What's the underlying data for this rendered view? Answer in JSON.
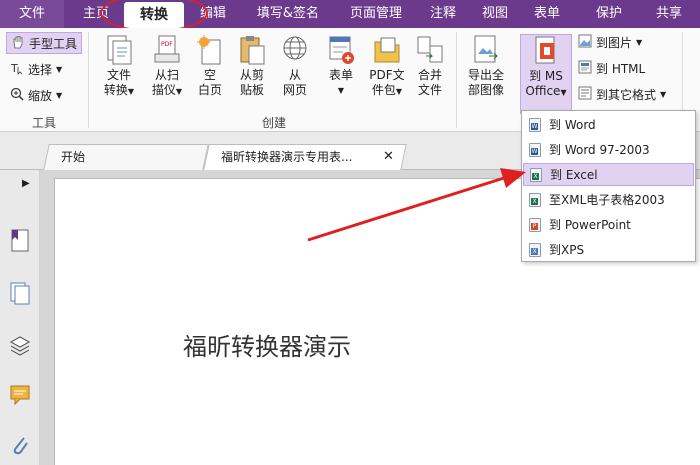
{
  "menu_tabs": {
    "file": "文件",
    "home": "主页",
    "convert": "转换",
    "edit": "编辑",
    "fill_sign": "填写&签名",
    "page_manage": "页面管理",
    "annotate": "注释",
    "view": "视图",
    "form": "表单",
    "protect": "保护",
    "share": "共享"
  },
  "tools_group": {
    "hand_tool": "手型工具",
    "select": "选择",
    "zoom": "缩放",
    "label": "工具"
  },
  "create_group": {
    "label": "创建",
    "file_convert": [
      "文件",
      "转换"
    ],
    "from_scanner": [
      "从扫",
      "描仪"
    ],
    "blank_page": [
      "空",
      "白页"
    ],
    "from_clipboard": [
      "从剪",
      "贴板"
    ],
    "from_web": [
      "从",
      "网页"
    ],
    "form": [
      "表单",
      ""
    ],
    "pdf_package": [
      "PDF文",
      "件包"
    ],
    "merge_files": [
      "合并",
      "文件"
    ]
  },
  "export_group": {
    "export_all_images": [
      "导出全",
      "部图像"
    ],
    "to_ms_office": [
      "到 MS",
      "Office"
    ],
    "to_image": "到图片",
    "to_html": "到 HTML",
    "to_other": "到其它格式"
  },
  "doc_tabs": {
    "start": "开始",
    "current": "福昕转换器演示专用表..."
  },
  "page_text": "福昕转换器演示",
  "dropdown_items": [
    {
      "label": "到 Word",
      "type": "word"
    },
    {
      "label": "到 Word 97-2003",
      "type": "word"
    },
    {
      "label": "到 Excel",
      "type": "excel"
    },
    {
      "label": "至XML电子表格2003",
      "type": "excel"
    },
    {
      "label": "到 PowerPoint",
      "type": "ppt"
    },
    {
      "label": "到XPS",
      "type": "xps"
    }
  ],
  "colors": {
    "tabbar": "#6b3a8c",
    "highlight": "#e2d2f2",
    "annotation_red": "#e02020"
  }
}
